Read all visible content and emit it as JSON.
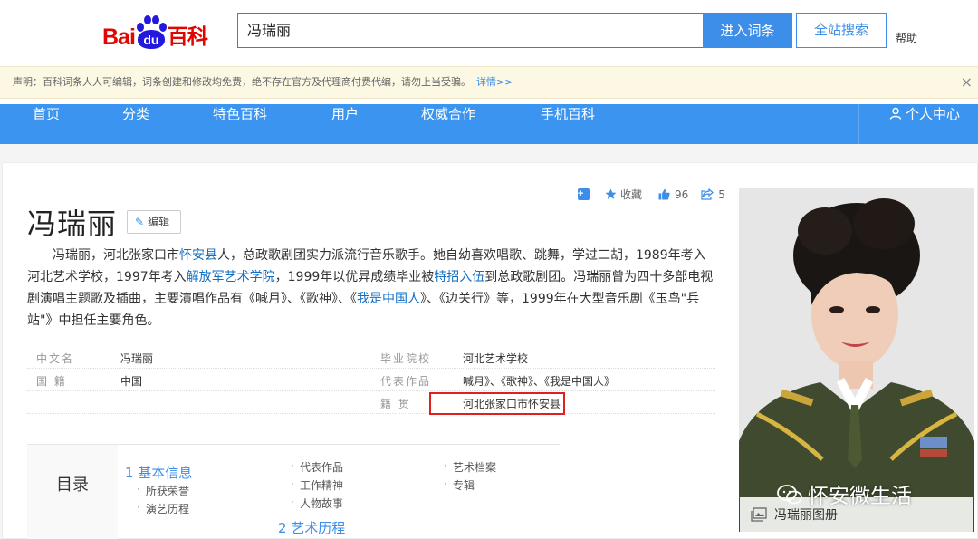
{
  "header": {
    "logo_bai": "Bai",
    "logo_du": "du",
    "logo_baike": "百科",
    "search_value": "冯瑞丽",
    "enter_button": "进入词条",
    "site_search_button": "全站搜索",
    "help": "帮助"
  },
  "notice": {
    "text": "声明：百科词条人人可编辑，词条创建和修改均免费，绝不存在官方及代理商付费代编，请勿上当受骗。",
    "link": "详情>>",
    "close": "×"
  },
  "nav": {
    "items": [
      "首页",
      "分类",
      "特色百科",
      "用户",
      "权威合作",
      "手机百科"
    ],
    "user_center": "个人中心"
  },
  "tools": {
    "collect": "收藏",
    "likes": "96",
    "shares": "5"
  },
  "entry": {
    "title": "冯瑞丽",
    "edit": "编辑",
    "summary_parts": [
      "冯瑞丽，河北张家口市",
      "怀安县",
      "人，总政歌剧团实力派流行音乐歌手。她自幼喜欢唱歌、跳舞，学过二胡，1989年考入河北艺术学校，1997年考入",
      "解放军艺术学院",
      "，1999年以优异成绩毕业被",
      "特招入伍",
      "到总政歌剧团。冯瑞丽曾为四十多部电视剧演唱主题歌及插曲，主要演唱作品有《喊月》、《歌神》、《",
      "我是中国人",
      "》、《边关行》等，1999年在大型音乐剧《玉鸟\"兵站\"》中担任主要角色。"
    ]
  },
  "info": {
    "row1": {
      "k1": "中文名",
      "v1": "冯瑞丽",
      "k2": "毕业院校",
      "v2": "河北艺术学校"
    },
    "row2": {
      "k1": "国 籍",
      "v1": "中国",
      "k2": "代表作品",
      "v2": "喊月》、《歌神》、《我是中国人》"
    },
    "row3": {
      "k2": "籍 贯",
      "v2": "河北张家口市怀安县"
    }
  },
  "toc": {
    "label": "目录",
    "h1": "1  基本信息",
    "h1_subs": [
      "所获荣誉",
      "演艺历程"
    ],
    "col2": [
      "代表作品",
      "工作精神",
      "人物故事"
    ],
    "h2": "2  艺术历程",
    "col3": [
      "艺术档案",
      "专辑"
    ]
  },
  "photo": {
    "caption": "冯瑞丽图册",
    "watermark": "怀安微生活"
  },
  "colors": {
    "nav_blue": "#3b95f0",
    "baidu_red": "#e10601",
    "baidu_blue": "#2319dc",
    "link_blue": "#136ec2",
    "highlight_red": "#e02020"
  }
}
